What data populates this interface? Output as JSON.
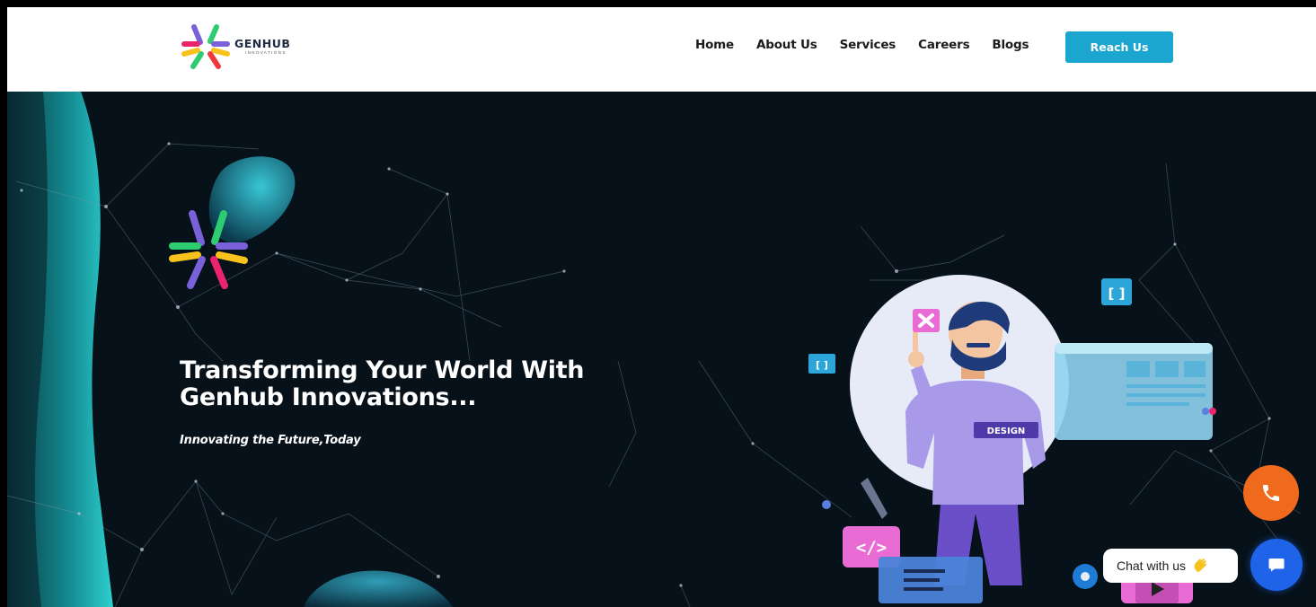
{
  "brand": {
    "name": "GENHUB",
    "tagline": "INNOVATIONS",
    "colors": {
      "green": "#2ecc71",
      "purple": "#7b61d9",
      "yellow": "#f7c21b",
      "pink": "#e8246d",
      "red": "#f0383c"
    }
  },
  "nav": {
    "items": [
      "Home",
      "About Us",
      "Services",
      "Careers",
      "Blogs"
    ],
    "cta_label": "Reach Us",
    "cta_color": "#1ba6cf"
  },
  "hero": {
    "title_line1": "Transforming Your World With",
    "title_line2": "Genhub Innovations...",
    "subtitle": "Innovating the Future,Today",
    "illustration": {
      "shirt_label": "DESIGN",
      "code_tag": "</>",
      "bracket_tag": "[ ]"
    }
  },
  "widgets": {
    "chat_label": "Chat with us",
    "call_icon": "phone-icon",
    "chat_icon": "chat-bubble-icon",
    "call_color": "#f06a1e",
    "chat_color": "#1e63e8"
  }
}
